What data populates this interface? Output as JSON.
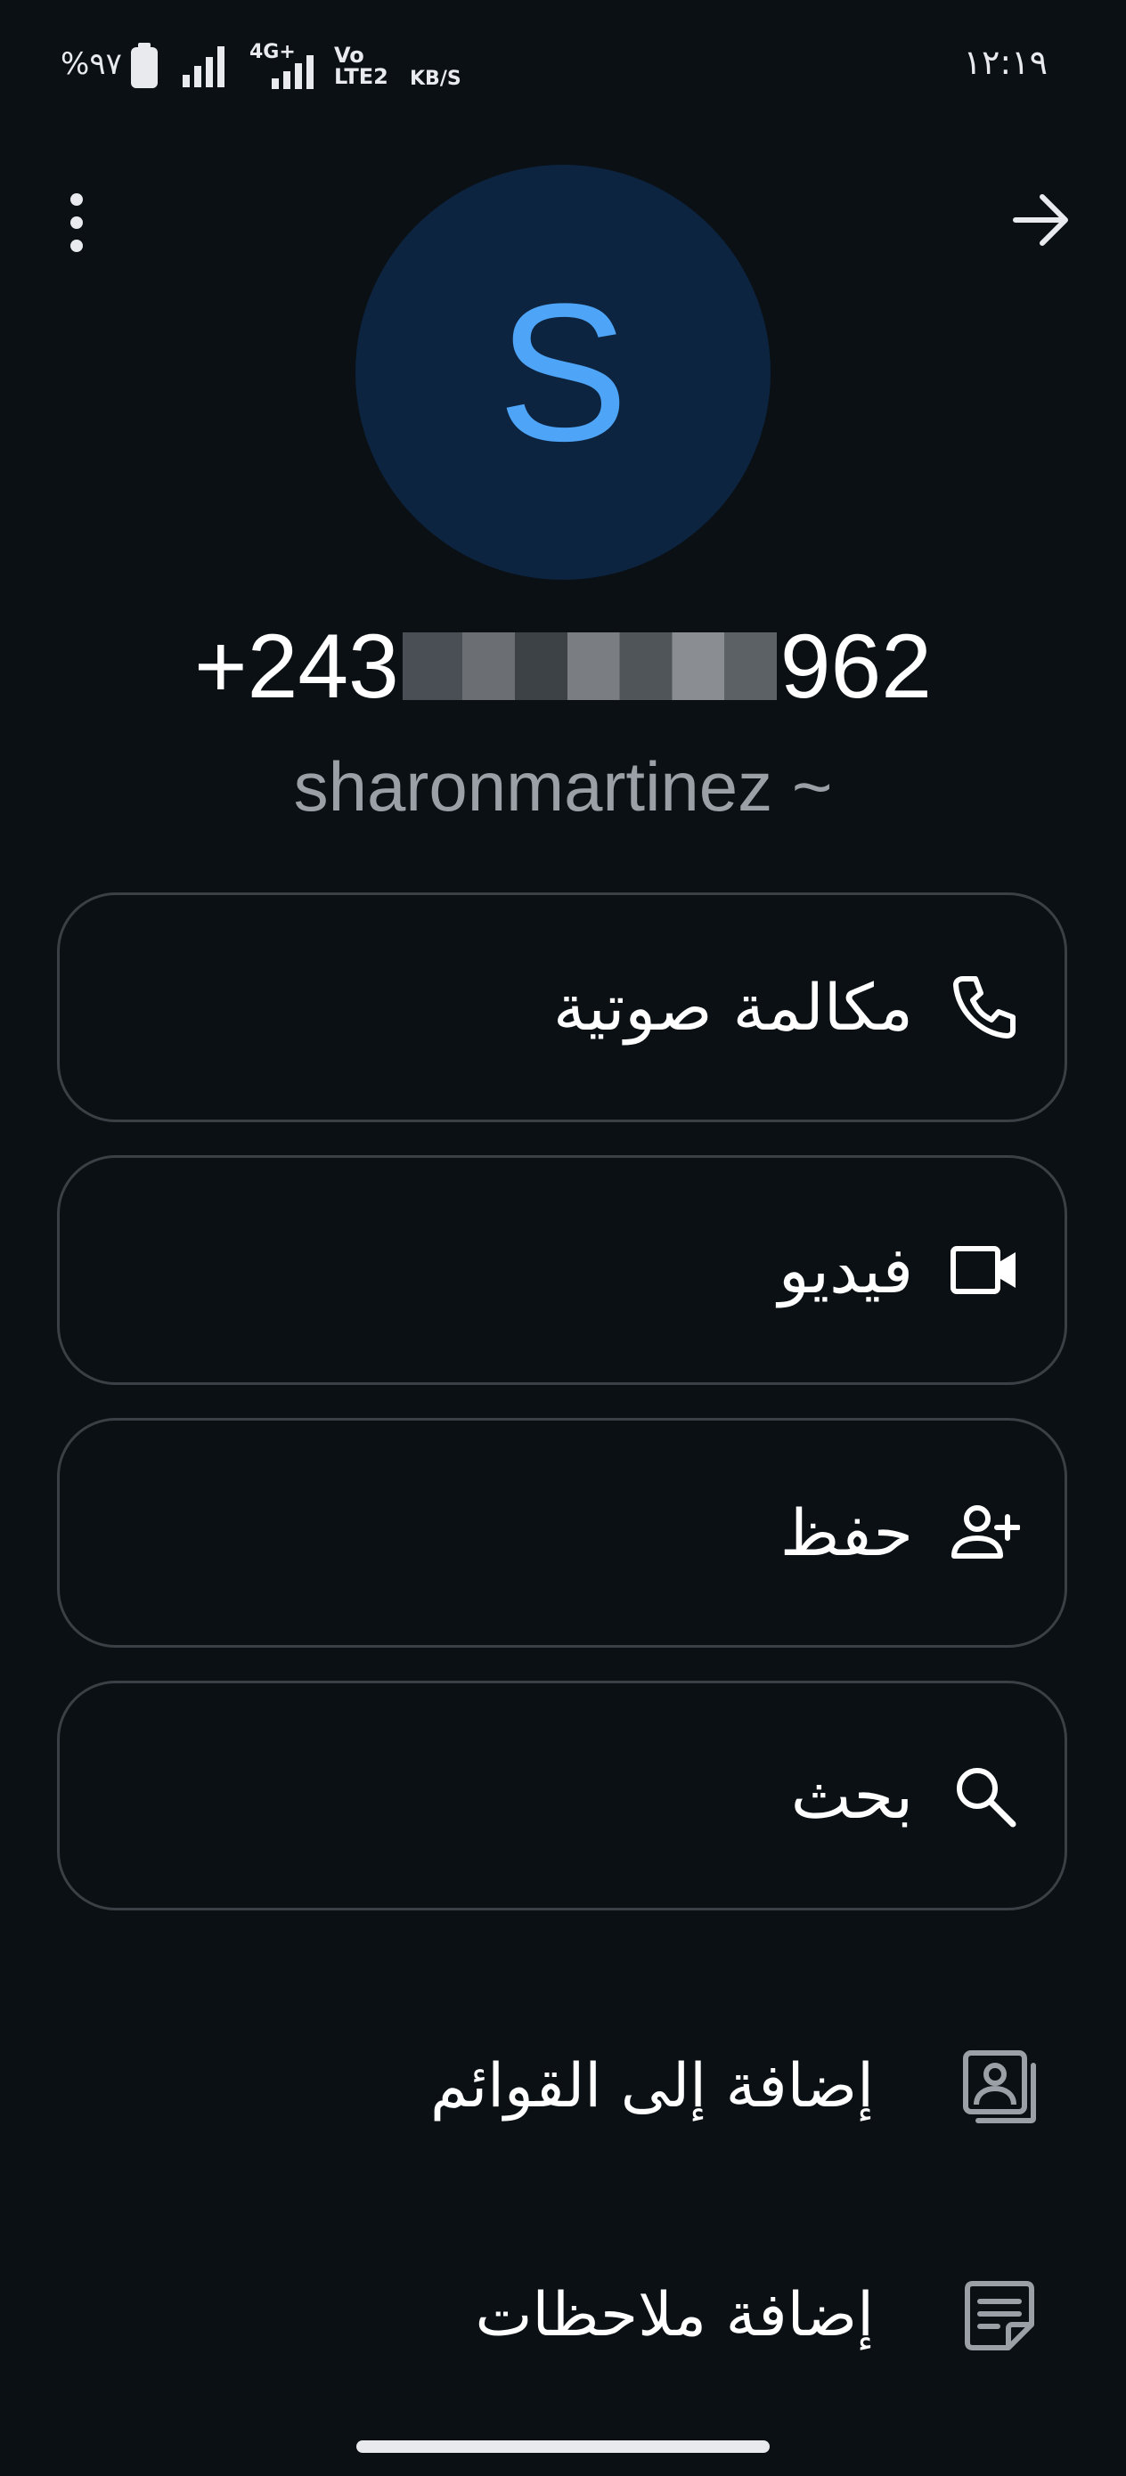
{
  "status_bar": {
    "battery": "%٩٧",
    "network": "4G+",
    "volte": "Vo LTE2",
    "speed_unit": "KB/S",
    "time": "١٢:١٩"
  },
  "contact": {
    "avatar_letter": "S",
    "phone_prefix": "+243",
    "phone_suffix": "962",
    "username": "sharonmartinez ~"
  },
  "actions": [
    {
      "label": "مكالمة صوتية",
      "icon": "phone-icon"
    },
    {
      "label": "فيديو",
      "icon": "video-icon"
    },
    {
      "label": "حفظ",
      "icon": "add-person-icon"
    },
    {
      "label": "بحث",
      "icon": "search-icon"
    }
  ],
  "list_items": [
    {
      "label": "إضافة إلى القوائم",
      "icon": "contact-list-icon"
    },
    {
      "label": "إضافة ملاحظات",
      "icon": "note-icon"
    }
  ],
  "colors": {
    "background": "#0b1014",
    "avatar_bg": "#0c2440",
    "avatar_letter": "#4ea4f6",
    "border": "#3a4045",
    "secondary_text": "#9aa0a6"
  }
}
